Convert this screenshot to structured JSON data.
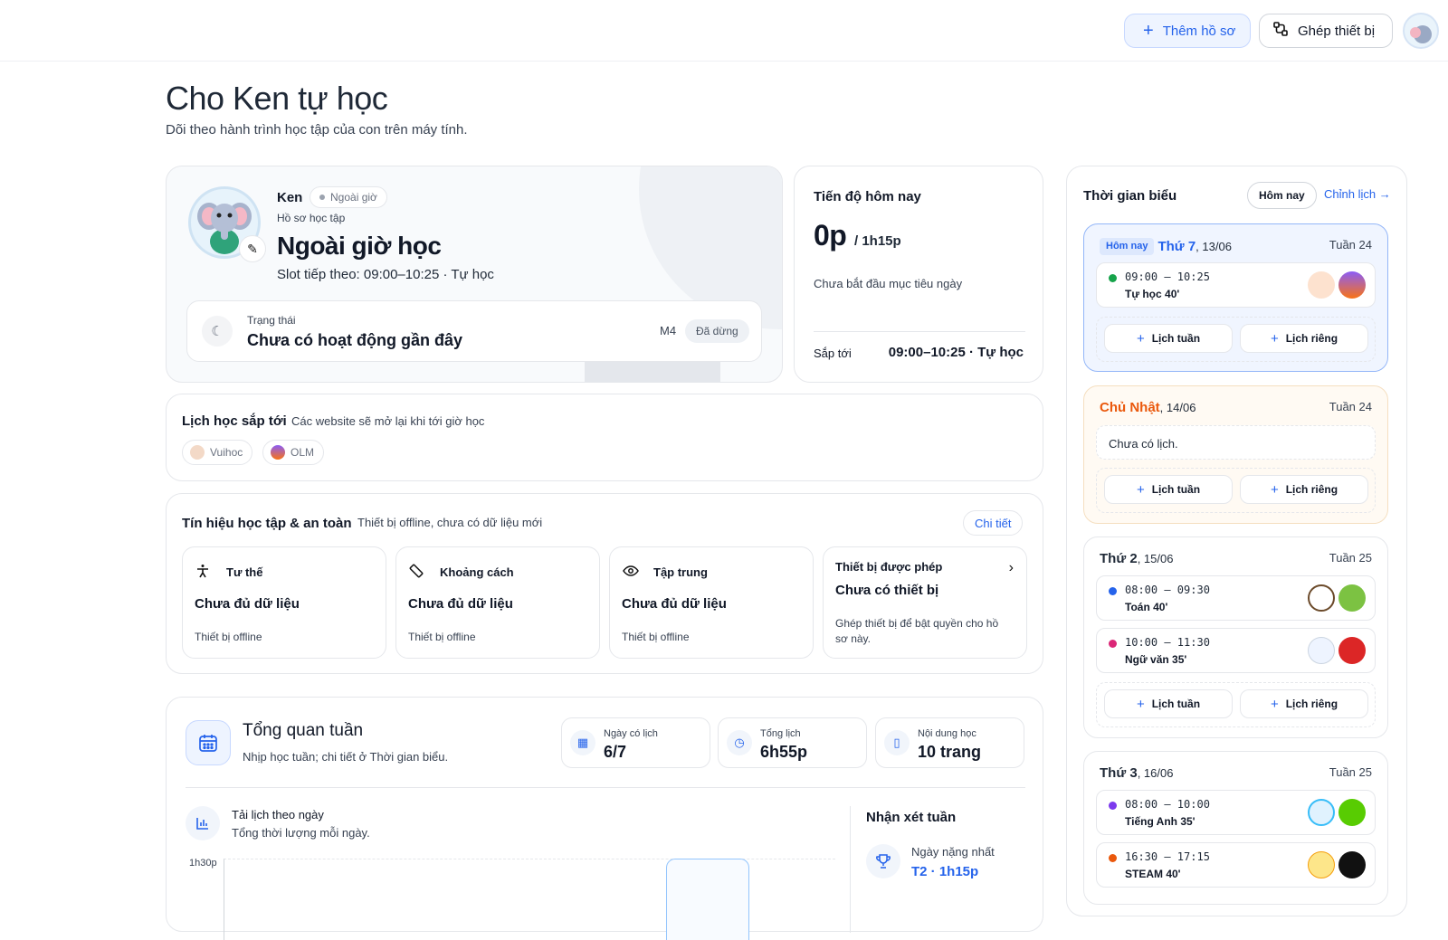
{
  "topbar": {
    "add_profile_label": "Thêm hồ sơ",
    "pair_device_label": "Ghép thiết bị"
  },
  "page": {
    "title": "Cho Ken tự học",
    "subtitle": "Dõi theo hành trình học tập của con trên máy tính."
  },
  "profile": {
    "name": "Ken",
    "mode_badge": "Ngoài giờ",
    "profile_label": "Hồ sơ học tập",
    "mode_title": "Ngoài giờ học",
    "next_slot": "Slot tiếp theo: 09:00–10:25 · Tự học",
    "status_label": "Trạng thái",
    "status_value": "Chưa có hoạt động gần đây",
    "device_code": "M4",
    "device_state": "Đã dừng"
  },
  "progress": {
    "title": "Tiến độ hôm nay",
    "done": "0p",
    "goal": "/ 1h15p",
    "note": "Chưa bắt đầu mục tiêu ngày",
    "next_label": "Sắp tới",
    "next_value": "09:00–10:25 · Tự học"
  },
  "upcoming": {
    "title": "Lịch học sắp tới",
    "subtitle": "Các website sẽ mở lại khi tới giờ học",
    "sites": [
      "Vuihoc",
      "OLM"
    ]
  },
  "signals": {
    "title": "Tín hiệu học tập & an toàn",
    "subtitle": "Thiết bị offline, chưa có dữ liệu mới",
    "detail_label": "Chi tiết",
    "cards": [
      {
        "icon": "posture-icon",
        "label": "Tư thế",
        "value": "Chưa đủ dữ liệu",
        "note": "Thiết bị offline"
      },
      {
        "icon": "ruler-icon",
        "label": "Khoảng cách",
        "value": "Chưa đủ dữ liệu",
        "note": "Thiết bị offline"
      },
      {
        "icon": "eye-icon",
        "label": "Tập trung",
        "value": "Chưa đủ dữ liệu",
        "note": "Thiết bị offline"
      }
    ],
    "devices": {
      "label": "Thiết bị được phép",
      "value": "Chưa có thiết bị",
      "note": "Ghép thiết bị để bật quyền cho hồ sơ này."
    }
  },
  "weekly": {
    "title": "Tổng quan tuần",
    "subtitle": "Nhịp học tuần; chi tiết ở Thời gian biểu.",
    "stats": [
      {
        "icon": "calendar-icon",
        "label": "Ngày có lịch",
        "value": "6/7"
      },
      {
        "icon": "clock-icon",
        "label": "Tổng lịch",
        "value": "6h55p"
      },
      {
        "icon": "book-icon",
        "label": "Nội dung học",
        "value": "10 trang"
      }
    ],
    "load": {
      "title": "Tải lịch theo ngày",
      "subtitle": "Tổng thời lượng mỗi ngày.",
      "y_tick": "1h30p"
    },
    "review": {
      "title": "Nhận xét tuần",
      "heaviest_label": "Ngày nặng nhất",
      "heaviest_value": "T2 · 1h15p"
    }
  },
  "chart_data": {
    "type": "bar",
    "title": "Tải lịch theo ngày",
    "ylabel": "",
    "y_ticks": [
      "1h30p"
    ],
    "bars_visible_minutes": [
      90
    ],
    "grid": true
  },
  "timetable": {
    "title": "Thời gian biểu",
    "today_btn": "Hôm nay",
    "edit_link": "Chỉnh lịch →",
    "add_week": "Lịch tuần",
    "add_private": "Lịch riêng",
    "days": [
      {
        "today_tag": "Hôm nay",
        "name": "Thứ 7",
        "date": ", 13/06",
        "week": "Tuần 24",
        "slots": [
          {
            "time": "09:00 – 10:25",
            "subject": "Tự học 40'",
            "color": "#16a34a"
          }
        ]
      },
      {
        "name": "Chủ Nhật",
        "date": ", 14/06",
        "week": "Tuần 24",
        "empty": "Chưa có lịch."
      },
      {
        "name": "Thứ 2",
        "date": ", 15/06",
        "week": "Tuần 25",
        "slots": [
          {
            "time": "08:00 – 09:30",
            "subject": "Toán 40'",
            "color": "#2563eb"
          },
          {
            "time": "10:00 – 11:30",
            "subject": "Ngữ văn 35'",
            "color": "#db2777"
          }
        ]
      },
      {
        "name": "Thứ 3",
        "date": ", 16/06",
        "week": "Tuần 25",
        "slots": [
          {
            "time": "08:00 – 10:00",
            "subject": "Tiếng Anh 35'",
            "color": "#7c3aed"
          },
          {
            "time": "16:30 – 17:15",
            "subject": "STEAM 40'",
            "color": "#ea580c"
          }
        ]
      }
    ]
  },
  "colors": {
    "accent": "#2563eb",
    "today_bg": "#f0f5ff",
    "sunday_name": "#ea580c"
  }
}
